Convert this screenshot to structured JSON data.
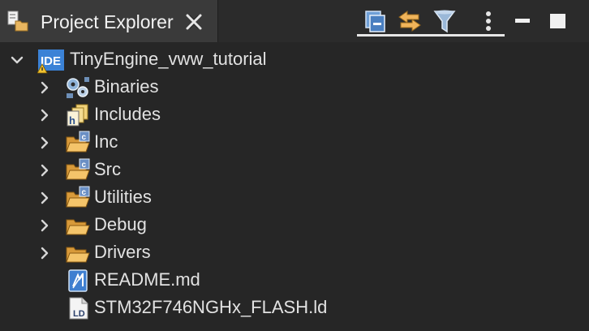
{
  "tab": {
    "title": "Project Explorer"
  },
  "toolbar": {
    "icons": [
      "collapse-all-icon",
      "link-with-editor-icon",
      "filter-icon",
      "view-menu-icon",
      "minimize-icon",
      "maximize-icon"
    ]
  },
  "tree": {
    "project": {
      "label": "TinyEngine_vww_tutorial",
      "icon": "ide-project-icon",
      "expanded": true
    },
    "items": [
      {
        "label": "Binaries",
        "icon": "binaries-icon",
        "expandable": true
      },
      {
        "label": "Includes",
        "icon": "includes-icon",
        "expandable": true
      },
      {
        "label": "Inc",
        "icon": "source-folder-icon",
        "expandable": true
      },
      {
        "label": "Src",
        "icon": "source-folder-icon",
        "expandable": true
      },
      {
        "label": "Utilities",
        "icon": "source-folder-icon",
        "expandable": true
      },
      {
        "label": "Debug",
        "icon": "folder-icon",
        "expandable": true
      },
      {
        "label": "Drivers",
        "icon": "folder-icon",
        "expandable": true
      },
      {
        "label": "README.md",
        "icon": "markdown-file-icon",
        "expandable": false
      },
      {
        "label": "STM32F746NGHx_FLASH.ld",
        "icon": "linker-file-icon",
        "expandable": false
      }
    ]
  },
  "colors": {
    "background": "#262626",
    "tab": "#3a3a3a",
    "text": "#e2e2e2",
    "folder": "#e8b660",
    "accent_blue": "#4a8fd8"
  }
}
